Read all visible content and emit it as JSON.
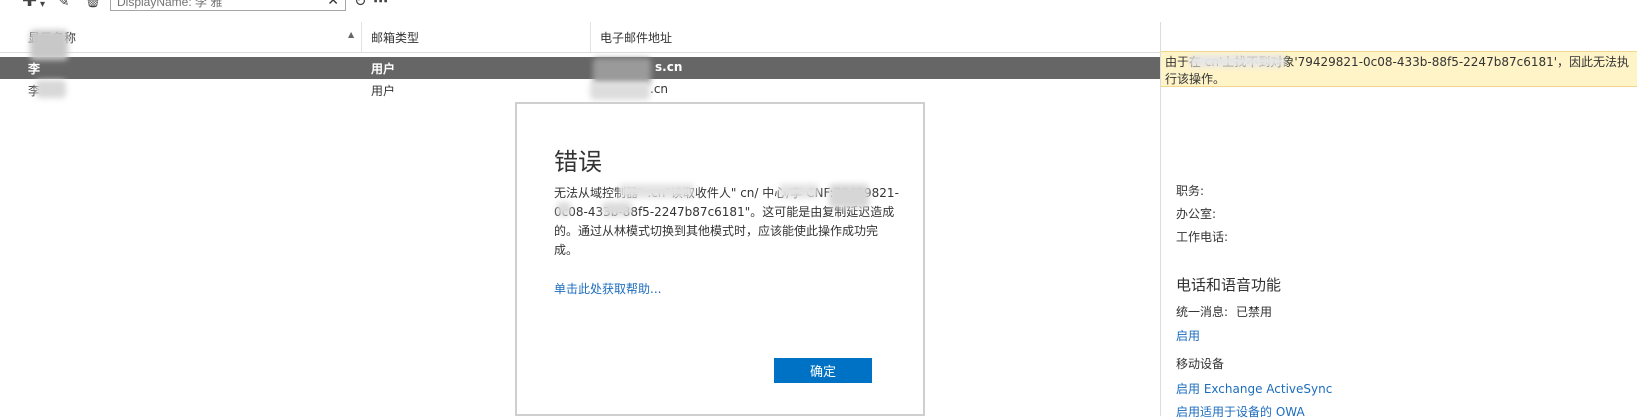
{
  "toolbar": {
    "search": {
      "placeholder": "DisplayName: 李 雅",
      "clear_glyph": "✕"
    }
  },
  "grid": {
    "columns": [
      "显示名称",
      "邮箱类型",
      "电子邮件地址"
    ],
    "rows": [
      {
        "name": "李",
        "type": "用户",
        "email": "s.cn",
        "selected": true
      },
      {
        "name": "李",
        "type": "用户",
        "email": ".cn",
        "selected": false
      }
    ]
  },
  "details": {
    "error_banner": "由于在                    cn'上找不到对象'79429821-0c08-433b-88f5-2247b87c6181'，因此无法执行该操作。",
    "fields": [
      "职务:",
      "办公室:",
      "工作电话:"
    ],
    "phone_section_title": "电话和语音功能",
    "um_label": "统一消息:",
    "um_value": "已禁用",
    "um_enable_link": "启用",
    "mobile_title": "移动设备",
    "mobile_links": [
      "启用 Exchange ActiveSync",
      "启用适用于设备的 OWA"
    ]
  },
  "dialog": {
    "title": "错误",
    "message": "无法从域控制器\"              .cn\"读取收件人\"         cn/          中心/李     CNF:79429821-0c08-433b-88f5-2247b87c6181\"。这可能是由复制延迟造成的。通过从林模式切换到其他模式时，应该能使此操作成功完成。",
    "help_link": "单击此处获取帮助...",
    "ok_button": "确定"
  },
  "colors": {
    "accent": "#0072c6",
    "selection": "#666666",
    "banner": "#fff4c8",
    "link": "#1e6dbd"
  },
  "icons": [
    "add-icon",
    "dropdown-caret-icon",
    "edit-icon",
    "delete-icon",
    "refresh-icon",
    "more-icon"
  ]
}
